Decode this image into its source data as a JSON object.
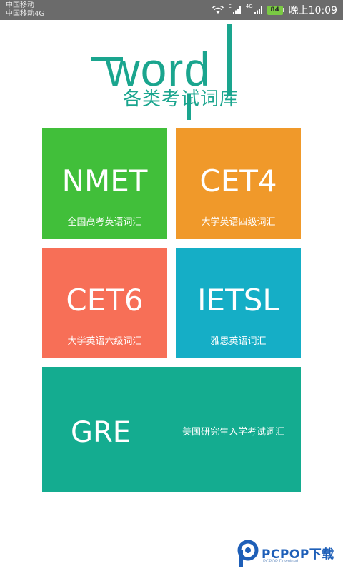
{
  "status_bar": {
    "carrier_1": "中国移动",
    "carrier_2": "中国移动4G",
    "signal_1_tag": "E",
    "signal_2_tag": "4G",
    "battery": "84",
    "time": "晚上10:09"
  },
  "logo": {
    "word": "word",
    "subtitle": "各类考试词库",
    "color": "#1aa58e"
  },
  "tiles": [
    {
      "id": "nmet",
      "title": "NMET",
      "subtitle": "全国高考英语词汇",
      "color": "#41bf3a"
    },
    {
      "id": "cet4",
      "title": "CET4",
      "subtitle": "大学英语四级词汇",
      "color": "#f0992a"
    },
    {
      "id": "cet6",
      "title": "CET6",
      "subtitle": "大学英语六级词汇",
      "color": "#f76f57"
    },
    {
      "id": "ietsl",
      "title": "IETSL",
      "subtitle": "雅思英语词汇",
      "color": "#15aec6"
    },
    {
      "id": "gre",
      "title": "GRE",
      "subtitle": "美国研究生入学考试词汇",
      "color": "#14ac90"
    }
  ],
  "watermark": {
    "brand": "PCPOP下载",
    "tagline": "PCPOP Download"
  }
}
